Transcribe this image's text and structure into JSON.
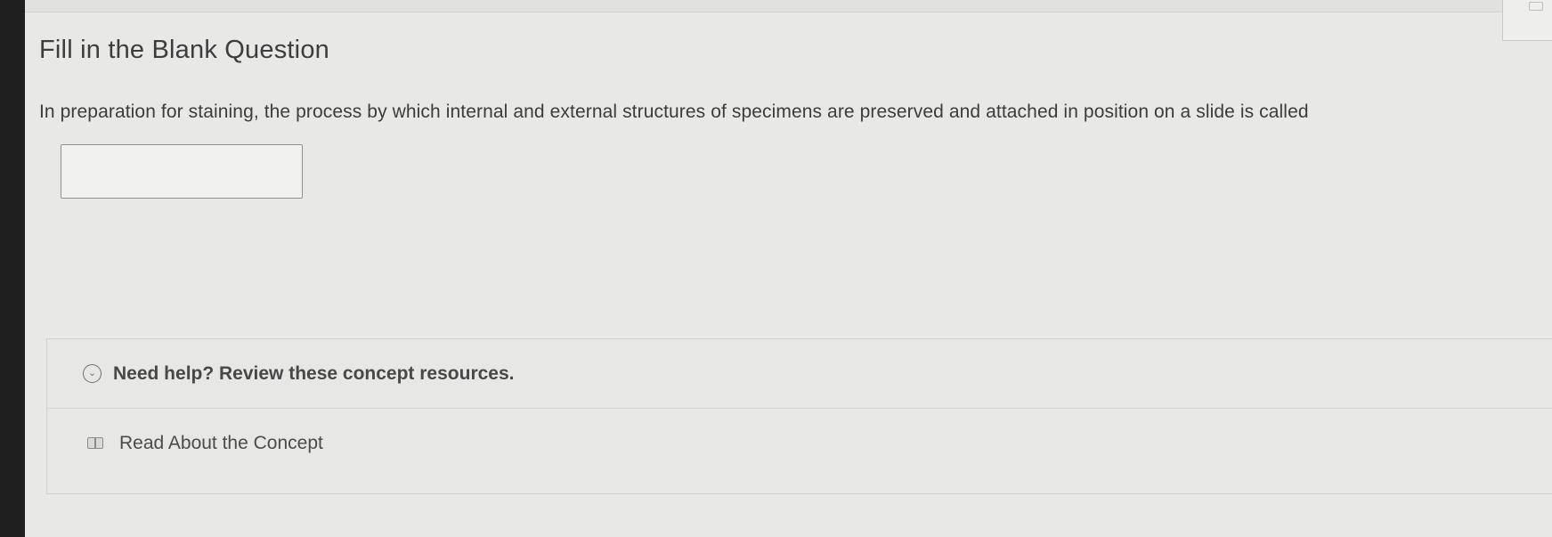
{
  "question": {
    "type_label": "Fill in the Blank Question",
    "text": "In preparation for staining, the process by which internal and external structures of specimens are preserved and attached in position on a slide is called",
    "answer_value": "",
    "answer_placeholder": ""
  },
  "help": {
    "toggle_icon": "chevron-down-circle-icon",
    "title": "Need help? Review these concept resources.",
    "resources": [
      {
        "icon": "book-icon",
        "label": "Read About the Concept"
      }
    ]
  }
}
